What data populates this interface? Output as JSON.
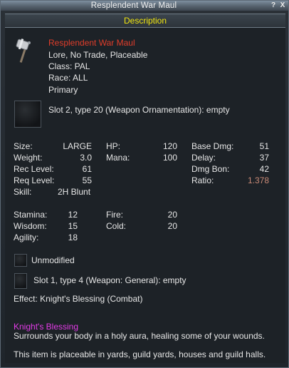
{
  "window": {
    "title": "Resplendent War Maul",
    "help_label": "?",
    "close_label": "X"
  },
  "header": {
    "section_label": "Description"
  },
  "item": {
    "icon": "war-maul-icon",
    "name": "Resplendent War Maul",
    "flags": "Lore, No Trade, Placeable",
    "class": "Class: PAL",
    "race": "Race: ALL",
    "slot": "Primary",
    "name_color": "#e03d2a"
  },
  "ornament_slot": {
    "text": "Slot 2, type 20 (Weapon Ornamentation): empty"
  },
  "stats": {
    "size_label": "Size:",
    "size": "LARGE",
    "weight_label": "Weight:",
    "weight": "3.0",
    "rec_label": "Rec Level:",
    "rec": "61",
    "req_label": "Req Level:",
    "req": "55",
    "skill_label": "Skill:",
    "skill": "2H Blunt",
    "hp_label": "HP:",
    "hp": "120",
    "mana_label": "Mana:",
    "mana": "100",
    "base_dmg_label": "Base Dmg:",
    "base_dmg": "51",
    "delay_label": "Delay:",
    "delay": "37",
    "dmg_bon_label": "Dmg Bon:",
    "dmg_bon": "42",
    "ratio_label": "Ratio:",
    "ratio": "1.378",
    "ratio_color": "#c98a76"
  },
  "attributes": {
    "stamina_label": "Stamina:",
    "stamina": "12",
    "wisdom_label": "Wisdom:",
    "wisdom": "15",
    "agility_label": "Agility:",
    "agility": "18",
    "fire_label": "Fire:",
    "fire": "20",
    "cold_label": "Cold:",
    "cold": "20"
  },
  "augment": {
    "unmodified": "Unmodified",
    "slot1": "Slot 1, type 4 (Weapon: General): empty"
  },
  "effect": {
    "text": "Effect: Knight's Blessing (Combat)"
  },
  "blessing": {
    "title": "Knight's Blessing",
    "desc": "Surrounds your body in a holy aura, healing some of your wounds.",
    "title_color": "#e23be6"
  },
  "footer": {
    "placeable": "This item is placeable in yards, guild yards, houses and guild halls."
  }
}
